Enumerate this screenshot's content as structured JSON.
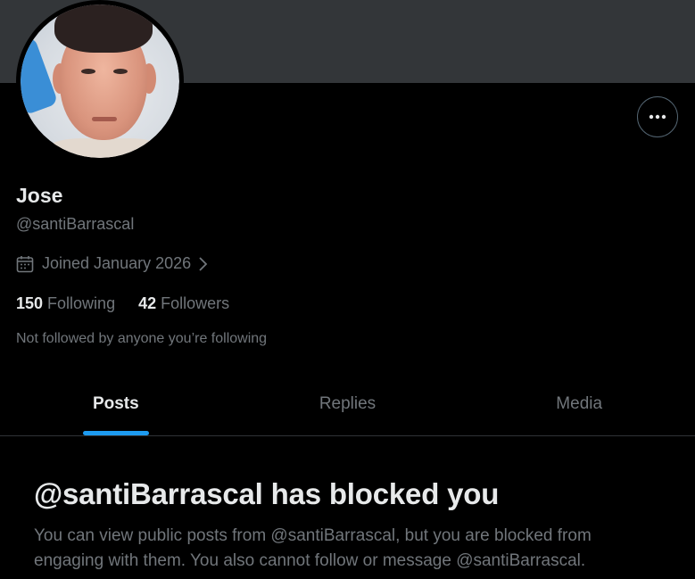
{
  "profile": {
    "name": "Jose",
    "handle": "@santiBarrascal",
    "joined": "Joined January 2026",
    "following_count": "150",
    "following_label": "Following",
    "followers_count": "42",
    "followers_label": "Followers",
    "followed_note": "Not followed by anyone you’re following"
  },
  "tabs": [
    {
      "label": "Posts",
      "active": true
    },
    {
      "label": "Replies",
      "active": false
    },
    {
      "label": "Media",
      "active": false
    }
  ],
  "blocked": {
    "title": "@santiBarrascal has blocked you",
    "body": "You can view public posts from @santiBarrascal, but you are blocked from engaging with them. You also cannot follow or message @santiBarrascal."
  },
  "icons": {
    "more": "more-horizontal-icon",
    "calendar": "calendar-icon",
    "chevron": "chevron-right-icon"
  },
  "colors": {
    "background": "#000000",
    "banner": "#333639",
    "primary_text": "#e7e9ea",
    "secondary_text": "#71767b",
    "accent": "#1d9bf0",
    "divider": "#2f3336"
  }
}
